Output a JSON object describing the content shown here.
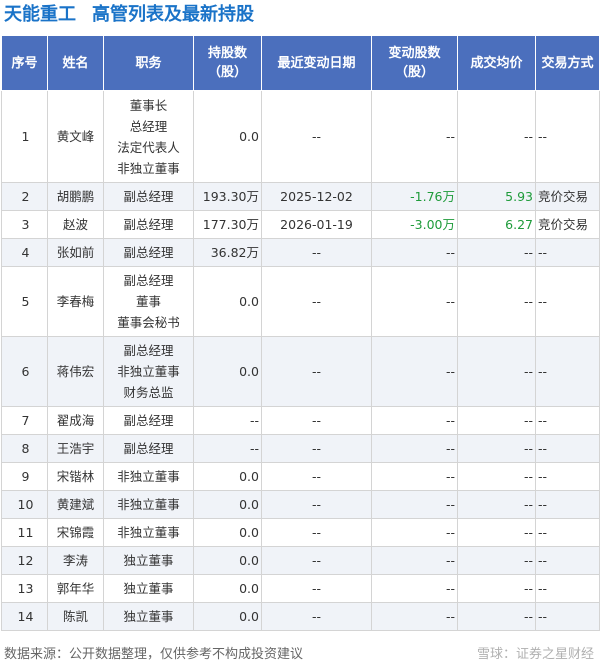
{
  "header": {
    "brand": "天能重工",
    "subtitle": "高管列表及最新持股"
  },
  "table": {
    "columns": [
      "序号",
      "姓名",
      "职务",
      "持股数\n（股）",
      "最近变动日期",
      "变动股数\n（股）",
      "成交均价",
      "交易方式"
    ],
    "rows": [
      {
        "idx": "1",
        "name": "黄文峰",
        "roles": [
          "董事长",
          "总经理",
          "法定代表人",
          "非独立董事"
        ],
        "holding": "0.0",
        "date": "--",
        "change": "--",
        "price": "--",
        "method": "--"
      },
      {
        "idx": "2",
        "name": "胡鹏鹏",
        "roles": [
          "副总经理"
        ],
        "holding": "193.30万",
        "date": "2025-12-02",
        "change": "-1.76万",
        "price": "5.93",
        "method": "竞价交易"
      },
      {
        "idx": "3",
        "name": "赵波",
        "roles": [
          "副总经理"
        ],
        "holding": "177.30万",
        "date": "2026-01-19",
        "change": "-3.00万",
        "price": "6.27",
        "method": "竞价交易"
      },
      {
        "idx": "4",
        "name": "张如前",
        "roles": [
          "副总经理"
        ],
        "holding": "36.82万",
        "date": "--",
        "change": "--",
        "price": "--",
        "method": "--"
      },
      {
        "idx": "5",
        "name": "李春梅",
        "roles": [
          "副总经理",
          "董事",
          "董事会秘书"
        ],
        "holding": "0.0",
        "date": "--",
        "change": "--",
        "price": "--",
        "method": "--"
      },
      {
        "idx": "6",
        "name": "蒋伟宏",
        "roles": [
          "副总经理",
          "非独立董事",
          "财务总监"
        ],
        "holding": "0.0",
        "date": "--",
        "change": "--",
        "price": "--",
        "method": "--"
      },
      {
        "idx": "7",
        "name": "翟成海",
        "roles": [
          "副总经理"
        ],
        "holding": "--",
        "date": "--",
        "change": "--",
        "price": "--",
        "method": "--"
      },
      {
        "idx": "8",
        "name": "王浩宇",
        "roles": [
          "副总经理"
        ],
        "holding": "--",
        "date": "--",
        "change": "--",
        "price": "--",
        "method": "--"
      },
      {
        "idx": "9",
        "name": "宋锴林",
        "roles": [
          "非独立董事"
        ],
        "holding": "0.0",
        "date": "--",
        "change": "--",
        "price": "--",
        "method": "--"
      },
      {
        "idx": "10",
        "name": "黄建斌",
        "roles": [
          "非独立董事"
        ],
        "holding": "0.0",
        "date": "--",
        "change": "--",
        "price": "--",
        "method": "--"
      },
      {
        "idx": "11",
        "name": "宋锦霞",
        "roles": [
          "非独立董事"
        ],
        "holding": "0.0",
        "date": "--",
        "change": "--",
        "price": "--",
        "method": "--"
      },
      {
        "idx": "12",
        "name": "李涛",
        "roles": [
          "独立董事"
        ],
        "holding": "0.0",
        "date": "--",
        "change": "--",
        "price": "--",
        "method": "--"
      },
      {
        "idx": "13",
        "name": "郭年华",
        "roles": [
          "独立董事"
        ],
        "holding": "0.0",
        "date": "--",
        "change": "--",
        "price": "--",
        "method": "--"
      },
      {
        "idx": "14",
        "name": "陈凯",
        "roles": [
          "独立董事"
        ],
        "holding": "0.0",
        "date": "--",
        "change": "--",
        "price": "--",
        "method": "--"
      }
    ]
  },
  "footer": {
    "source": "数据来源：公开数据整理，仅供参考不构成投资建议",
    "credit": "雪球：证券之星财经"
  },
  "colors": {
    "header_bg": "#4b6fbd",
    "title": "#1a73c8",
    "change_text": "#1e9b3a"
  }
}
